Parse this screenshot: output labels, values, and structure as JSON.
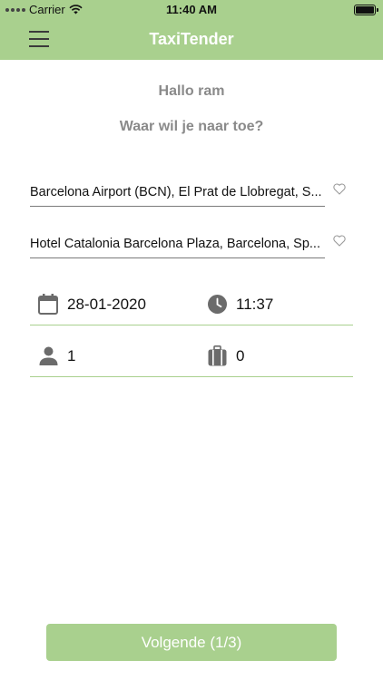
{
  "status_bar": {
    "carrier": "Carrier",
    "time": "11:40 AM"
  },
  "header": {
    "title": "TaxiTender"
  },
  "main": {
    "greeting": "Hallo ram",
    "question": "Waar wil je naar toe?",
    "from_address": "Barcelona Airport (BCN), El Prat de Llobregat, S...",
    "to_address": "Hotel Catalonia Barcelona Plaza, Barcelona, Sp...",
    "date": "28-01-2020",
    "time": "11:37",
    "passengers": "1",
    "luggage": "0"
  },
  "footer": {
    "next_button": "Volgende (1/3)"
  },
  "colors": {
    "accent": "#a9d08e",
    "title_text": "#ffffff",
    "muted_text": "#8a8a8a",
    "icon_gray": "#6b6b6b"
  }
}
